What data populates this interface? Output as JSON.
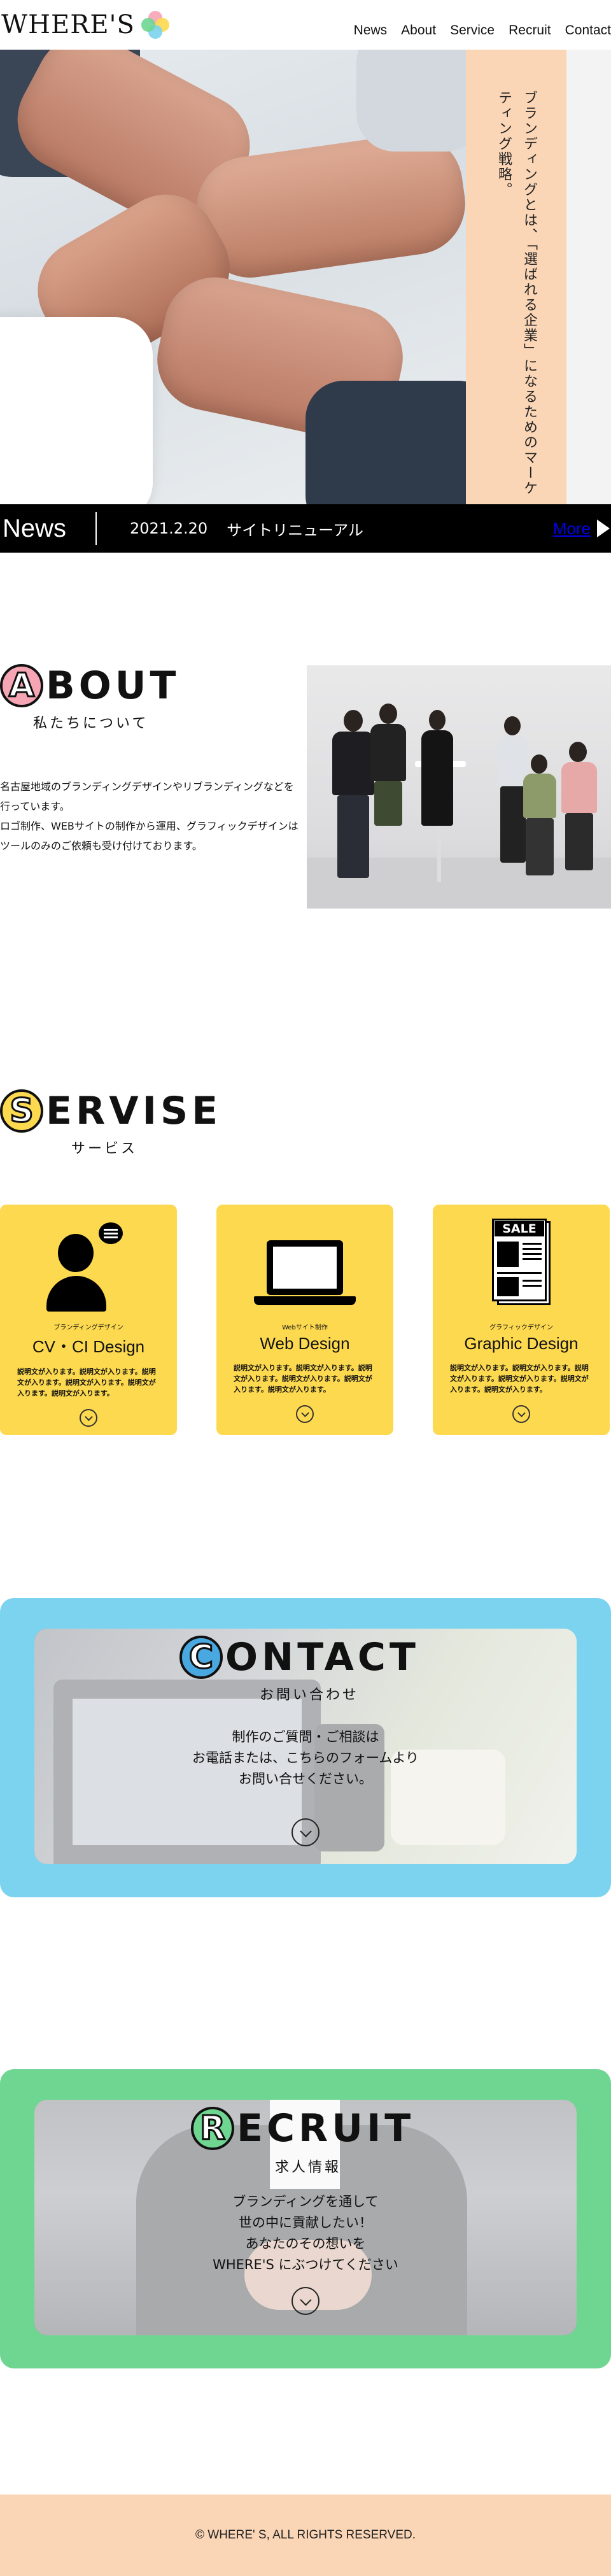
{
  "header": {
    "logo_text": "WHERE'S",
    "nav": [
      "News",
      "About",
      "Service",
      "Recruit",
      "Contact"
    ]
  },
  "hero": {
    "tagline": "ブランディングとは、「選ばれる企業」になるためのマーケティング戦略。"
  },
  "news": {
    "title": "News",
    "date": "2021.2.20",
    "text": "サイトリニューアル",
    "more": "More"
  },
  "about": {
    "initial": "A",
    "rest": "BOUT",
    "subtitle": "私たちについて",
    "body": [
      "名古屋地域のブランディングデザインやリブランディングなどを行っています。",
      "ロゴ制作、WEBサイトの制作から運用、グラフィックデザインはツールのみのご依頼も受け付けております。"
    ]
  },
  "service": {
    "initial": "S",
    "rest": "ERVISE",
    "subtitle": "サービス",
    "cards": [
      {
        "icon": "person-chat-icon",
        "small": "ブランディングデザイン",
        "title": "CV・CI Design",
        "desc": "説明文が入ります。説明文が入ります。説明文が入ります。説明文が入ります。説明文が入ります。説明文が入ります。"
      },
      {
        "icon": "laptop-icon",
        "small": "Webサイト制作",
        "title": "Web Design",
        "desc": "説明文が入ります。説明文が入ります。説明文が入ります。説明文が入ります。説明文が入ります。説明文が入ります。"
      },
      {
        "icon": "newspaper-icon",
        "small": "グラフィックデザイン",
        "title": "Graphic Design",
        "desc": "説明文が入ります。説明文が入ります。説明文が入ります。説明文が入ります。説明文が入ります。説明文が入ります。"
      }
    ],
    "newspaper_label": "SALE"
  },
  "contact": {
    "initial": "C",
    "rest": "ONTACT",
    "subtitle": "お問い合わせ",
    "lines": [
      "制作のご質問・ご相談は",
      "お電話または、こちらのフォームより",
      "お問い合せください。"
    ]
  },
  "recruit": {
    "initial": "R",
    "rest": "ECRUIT",
    "subtitle": "求人情報",
    "lines": [
      "ブランディングを通して",
      "世の中に貢献したい！",
      "あなたのその想いを",
      "WHERE'S にぶつけてください"
    ]
  },
  "footer": {
    "copyright": "© WHERE' S, ALL RIGHTS RESERVED."
  },
  "colors": {
    "accent_yellow": "#fdd94f",
    "peach": "#fbd6b6",
    "contact_blue": "#7bd3ef",
    "recruit_green": "#6fd692",
    "about_initial": "#f6a5b5",
    "service_initial": "#fdd94f",
    "contact_initial": "#4aa8e0",
    "recruit_initial": "#6fd692"
  }
}
